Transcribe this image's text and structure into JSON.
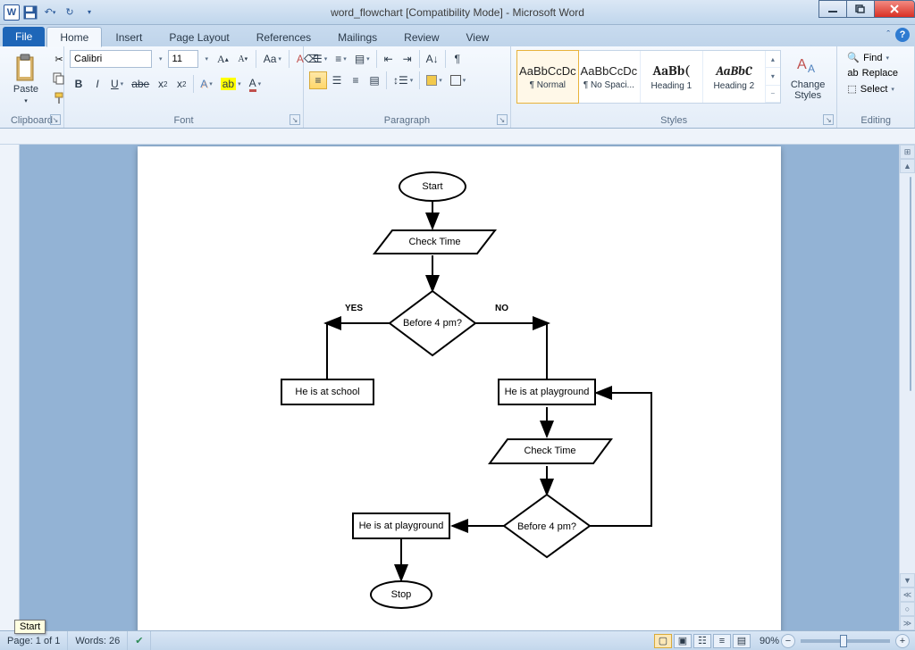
{
  "app": {
    "title": "word_flowchart [Compatibility Mode] - Microsoft Word"
  },
  "tabs": {
    "file": "File",
    "items": [
      "Home",
      "Insert",
      "Page Layout",
      "References",
      "Mailings",
      "Review",
      "View"
    ],
    "active": "Home"
  },
  "ribbon": {
    "clipboard": {
      "label": "Clipboard",
      "paste": "Paste"
    },
    "font": {
      "label": "Font",
      "name": "Calibri",
      "size": "11"
    },
    "paragraph": {
      "label": "Paragraph"
    },
    "styles": {
      "label": "Styles",
      "change": "Change\nStyles",
      "items": [
        {
          "preview": "AaBbCcDc",
          "name": "¶ Normal",
          "selected": true,
          "cls": ""
        },
        {
          "preview": "AaBbCcDc",
          "name": "¶ No Spaci...",
          "selected": false,
          "cls": ""
        },
        {
          "preview": "AaBb(",
          "name": "Heading 1",
          "selected": false,
          "cls": "h1"
        },
        {
          "preview": "AaBbC",
          "name": "Heading 2",
          "selected": false,
          "cls": "h2"
        }
      ]
    },
    "editing": {
      "label": "Editing",
      "find": "Find",
      "replace": "Replace",
      "select": "Select"
    }
  },
  "flowchart": {
    "start": "Start",
    "check1": "Check Time",
    "dec1": "Before 4 pm?",
    "yes": "YES",
    "no": "NO",
    "school": "He is at school",
    "play1": "He is at playground",
    "check2": "Check Time",
    "dec2": "Before 4 pm?",
    "play2": "He is at playground",
    "stop": "Stop"
  },
  "status": {
    "page": "Page: 1 of 1",
    "words": "Words: 26",
    "zoom": "90%",
    "tooltip": "Start"
  }
}
